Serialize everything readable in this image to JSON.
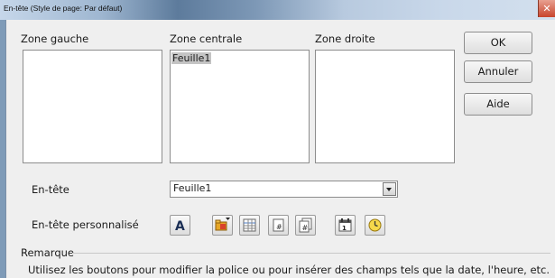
{
  "window": {
    "title": "En-tête (Style de page: Par défaut)"
  },
  "zones": [
    {
      "label": "Zone gauche",
      "content": ""
    },
    {
      "label": "Zone centrale",
      "content": "Feuille1"
    },
    {
      "label": "Zone droite",
      "content": ""
    }
  ],
  "buttons": {
    "ok": "OK",
    "cancel": "Annuler",
    "help": "Aide"
  },
  "header": {
    "label": "En-tête",
    "selected": "Feuille1"
  },
  "custom_header": {
    "label": "En-tête personnalisé"
  },
  "toolbar_icons": [
    "font-attributes-icon",
    "file-name-icon",
    "sheet-name-icon",
    "page-number-icon",
    "page-count-icon",
    "date-icon",
    "time-icon"
  ],
  "remark": {
    "label": "Remarque",
    "text": "Utilisez les boutons pour modifier la police ou pour insérer des champs tels que la date, l'heure, etc."
  }
}
